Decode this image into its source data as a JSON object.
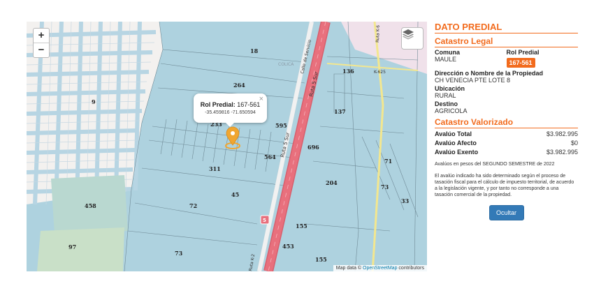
{
  "map": {
    "zoom_in": "+",
    "zoom_out": "−",
    "lot_numbers": [
      "18",
      "264",
      "9",
      "233",
      "595",
      "136",
      "137",
      "696",
      "564",
      "311",
      "45",
      "204",
      "71",
      "73",
      "33",
      "458",
      "72",
      "155",
      "97",
      "453",
      "73",
      "155"
    ],
    "road_labels": [
      "Ruta 5 Sur",
      "Ruta 5 Sur",
      "Calle de Servicio",
      "Ruta K-6",
      "K-625",
      "Ruta K-2",
      "5",
      "COLICA"
    ],
    "popup": {
      "title_label": "Rol Predial:",
      "title_value": "167-561",
      "coords": "-35.459816 -71.650594",
      "close": "×"
    },
    "attribution_prefix": "Map data ©",
    "attribution_link": "OpenStreetMap",
    "attribution_suffix": "contributors",
    "colors": {
      "parcel_fill": "#aed2df",
      "highway": "#e8707d",
      "marker": "#f0a631",
      "urban": "#f3f1ef"
    }
  },
  "panel": {
    "header": "DATO PREDIAL",
    "legal": {
      "title": "Catastro Legal",
      "comuna_label": "Comuna",
      "comuna_value": "MAULE",
      "rol_label": "Rol Predial",
      "rol_value": "167-561",
      "direccion_label": "Dirección o Nombre de la Propiedad",
      "direccion_value": "CH VENECIA PTE LOTE 8",
      "ubicacion_label": "Ubicación",
      "ubicacion_value": "RURAL",
      "destino_label": "Destino",
      "destino_value": "AGRICOLA"
    },
    "valorizado": {
      "title": "Catastro Valorizado",
      "rows": [
        {
          "label": "Avalúo Total",
          "value": "$3.982.995"
        },
        {
          "label": "Avalúo Afecto",
          "value": "$0"
        },
        {
          "label": "Avalúo Exento",
          "value": "$3.982.995"
        }
      ],
      "note1": "Avalúos en pesos del SEGUNDO SEMESTRE de 2022",
      "note2": "El avalúo indicado ha sido determinado según el proceso de tasación fiscal para el cálculo de impuesto territorial, de acuerdo a la legislación vigente, y por tanto no corresponde a una tasación comercial de la propiedad."
    },
    "button": "Ocultar",
    "accent": "#f26b1d",
    "button_color": "#337ab7"
  }
}
